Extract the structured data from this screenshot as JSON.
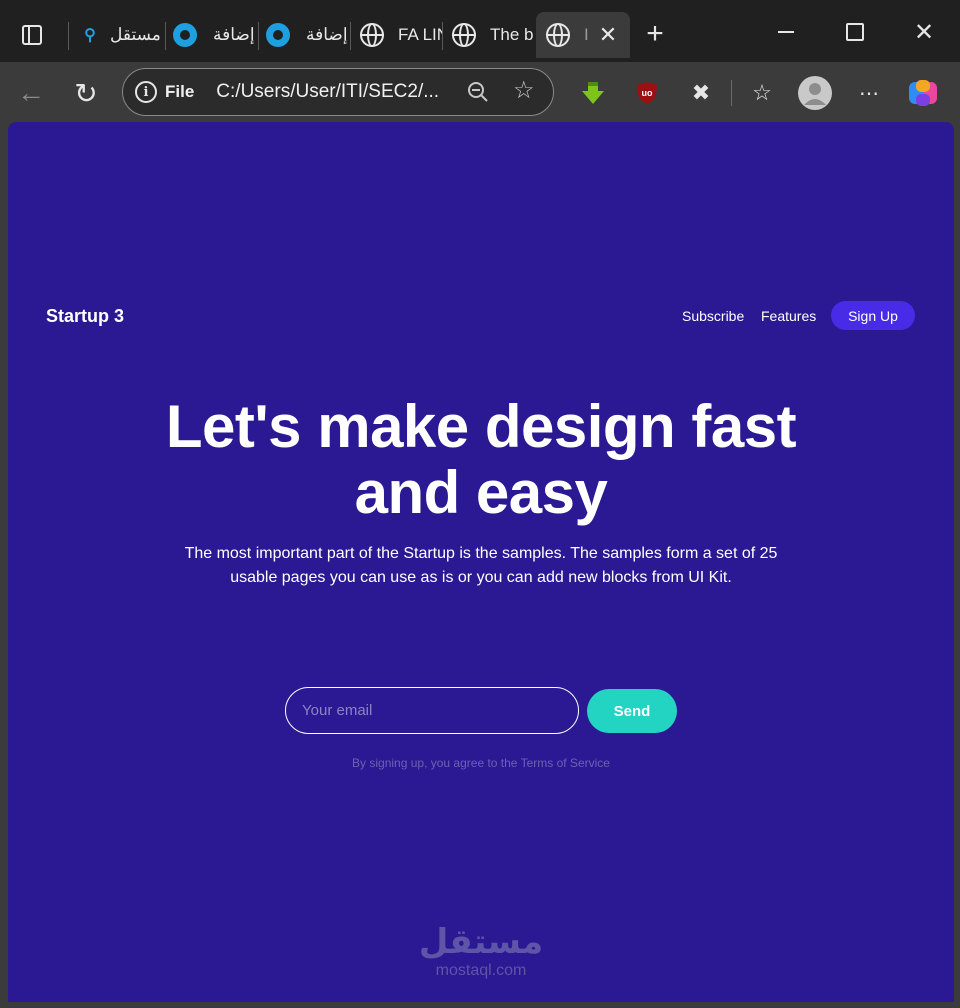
{
  "browser": {
    "tabs": [
      {
        "title": "مستقل",
        "favicon": "search-icon"
      },
      {
        "title": "إضافة",
        "favicon": "ring-icon"
      },
      {
        "title": "إضافة",
        "favicon": "ring-icon"
      },
      {
        "title": "FA LIN",
        "favicon": "globe-icon"
      },
      {
        "title": "The b",
        "favicon": "globe-icon"
      },
      {
        "title": "I",
        "favicon": "globe-icon",
        "active": true
      }
    ],
    "new_tab_glyph": "+",
    "close_glyph": "✕",
    "address": {
      "scheme_label": "File",
      "url": "C:/Users/User/ITI/SEC2/..."
    }
  },
  "page": {
    "nav": {
      "brand": "Startup 3",
      "links": [
        "Subscribe",
        "Features"
      ],
      "signup_label": "Sign Up"
    },
    "hero": {
      "title": "Let's make design fast and easy",
      "subtitle": "The most important part of the Startup is the samples. The samples form a set of 25 usable pages you can use as is or you can add new blocks from UI Kit."
    },
    "form": {
      "email_placeholder": "Your email",
      "email_value": "",
      "send_label": "Send",
      "terms": "By signing up, you agree to the Terms of Service"
    },
    "watermark": {
      "arabic": "مستقل",
      "latin": "mostaql.com"
    }
  },
  "colors": {
    "background": "#2a1993",
    "signup_button": "#482be7",
    "send_button": "#24d4c3",
    "browser_chrome": "#3b3b3b"
  }
}
